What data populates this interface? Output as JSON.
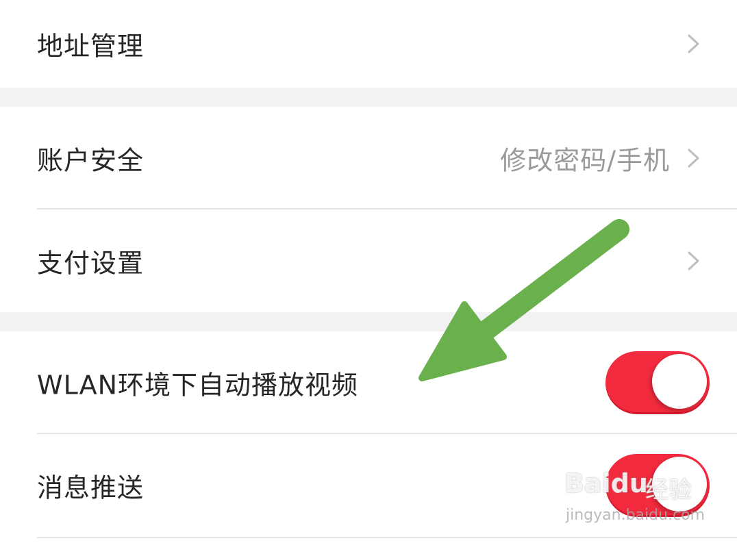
{
  "settings": {
    "address": {
      "label": "地址管理"
    },
    "account": {
      "label": "账户安全",
      "value": "修改密码/手机"
    },
    "payment": {
      "label": "支付设置"
    },
    "wlan_autoplay": {
      "label": "WLAN环境下自动播放视频",
      "enabled": true
    },
    "push": {
      "label": "消息推送",
      "enabled": true
    }
  },
  "icons": {
    "chevron": "chevron-right-icon",
    "arrow": "green-arrow-annotation"
  },
  "colors": {
    "toggle_on": "#f22a3e",
    "section_gap": "#f2f2f2",
    "arrow": "#6ab04c",
    "label": "#262626",
    "value": "#9a9a9a"
  },
  "watermark": {
    "brand": "Bai",
    "brand_suffix": "du",
    "cn": "经验",
    "url": "jingyan.baidu.com"
  }
}
